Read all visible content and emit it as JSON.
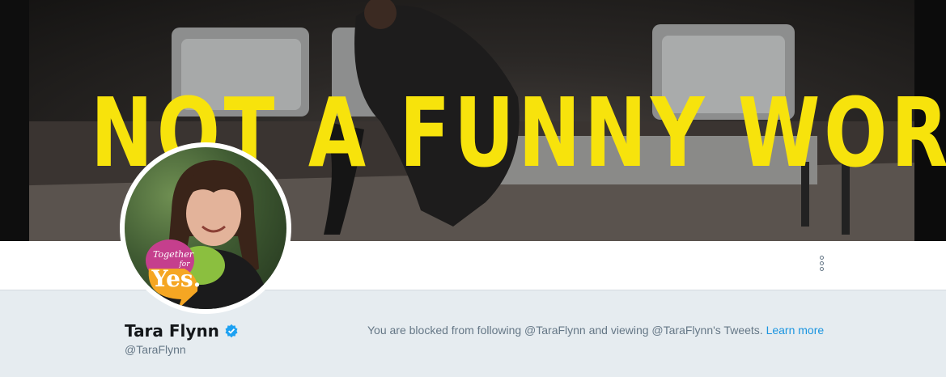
{
  "banner": {
    "headline": "NOT A FUNNY WORD"
  },
  "avatar": {
    "badge_top": "Together",
    "badge_mid": "for",
    "badge_word": "Yes."
  },
  "profile": {
    "name": "Tara Flynn",
    "handle": "@TaraFlynn",
    "verified": true
  },
  "notice": {
    "text": "You are blocked from following @TaraFlynn and viewing @TaraFlynn's Tweets.",
    "link_label": "Learn more"
  },
  "colors": {
    "accent": "#1b95e0",
    "banner_text": "#f7e30c",
    "verified": "#1da1f2"
  }
}
